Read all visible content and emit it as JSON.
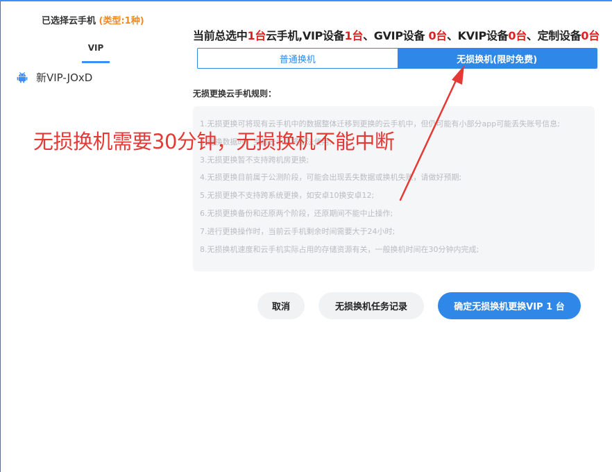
{
  "left_panel": {
    "selected_label": "已选择云手机",
    "type_label": "(类型:1种)",
    "tab_vip": "VIP",
    "device_name": "新VIP-JOxD"
  },
  "summary": {
    "p1": "当前总选中",
    "v1": "1台",
    "p2": "云手机,VIP设备",
    "v2": "1台",
    "p3": "、GVIP设备 ",
    "v3": "0台",
    "p4": "、KVIP设备",
    "v4": "0台",
    "p5": "、定制设备",
    "v5": "0台"
  },
  "tabs": {
    "normal": "普通换机",
    "lossless": "无损换机(限时免费)"
  },
  "rules": {
    "title": "无损更换云手机规则：",
    "items": [
      "1.无损更换可将现有云手机中的数据整体迁移到更换的云手机中，但仍可能有小部分app可能丢失账号信息;",
      "2.更换数据时，当前云手机将无法使用;",
      "3.无损更换暂不支持跨机房更换;",
      "4.无损更换目前属于公测阶段，可能会出现丢失数据或换机失败，请做好预期;",
      "5.无损更换不支持跨系统更换，如安卓10换安卓12;",
      "6.无损更换备份和还原两个阶段，还原期间不能中止操作;",
      "7.进行更换操作时，当前云手机剩余时间需要大于24小时;",
      "8.无损换机速度和云手机实际占用的存储资源有关，一般换机时间在30分钟内完成;"
    ]
  },
  "buttons": {
    "cancel": "取消",
    "records": "无损换机任务记录",
    "confirm": "确定无损换机更换VIP 1 台"
  },
  "annotation": {
    "text": "无损换机需要30分钟，无损换机不能中断"
  },
  "colors": {
    "accent": "#2f88e8",
    "highlight_red": "#e02020",
    "type_orange": "#f08a24",
    "annotation_red": "#e53935"
  },
  "icons": {
    "device": "android-icon"
  }
}
